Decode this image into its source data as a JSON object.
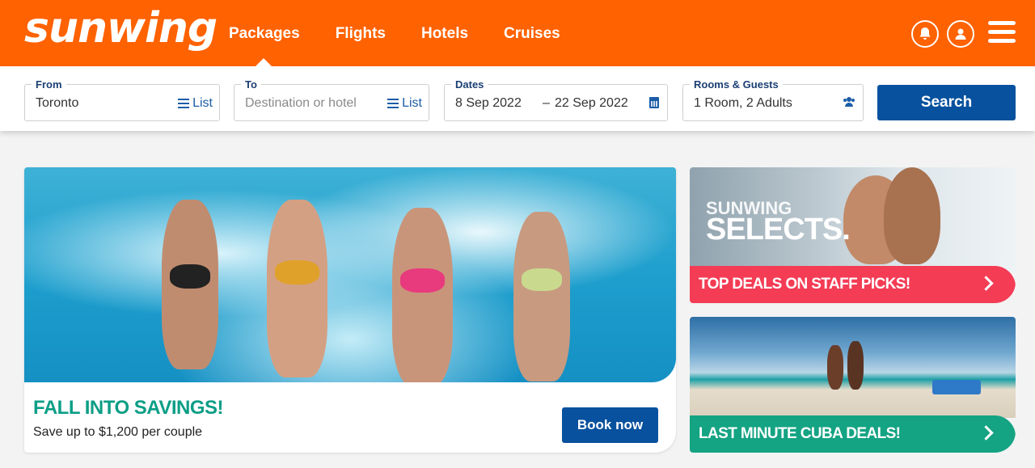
{
  "brand": {
    "logo_text": "sunwing",
    "accent": "#ff6200",
    "primary_button": "#07519e"
  },
  "nav": {
    "items": [
      {
        "label": "Packages",
        "active": true
      },
      {
        "label": "Flights"
      },
      {
        "label": "Hotels"
      },
      {
        "label": "Cruises"
      }
    ],
    "icons": [
      "bell-icon",
      "user-icon",
      "hamburger-menu-icon"
    ]
  },
  "search": {
    "from": {
      "label": "From",
      "value": "Toronto",
      "list_label": "List"
    },
    "to": {
      "label": "To",
      "placeholder": "Destination or hotel",
      "list_label": "List"
    },
    "dates": {
      "label": "Dates",
      "start": "8 Sep 2022",
      "separator": "–",
      "end": "22 Sep 2022"
    },
    "guests": {
      "label": "Rooms & Guests",
      "value": "1 Room, 2 Adults"
    },
    "button_label": "Search"
  },
  "hero": {
    "title": "FALL INTO SAVINGS!",
    "subtitle": "Save up to $1,200 per couple",
    "button_label": "Book now"
  },
  "cards": [
    {
      "image_text_line1": "SUNWING",
      "image_text_line2": "SELECTS.",
      "banner": "TOP DEALS ON STAFF PICKS!",
      "color": "#f43c55"
    },
    {
      "banner": "LAST MINUTE CUBA DEALS!",
      "color": "#14a383"
    }
  ]
}
